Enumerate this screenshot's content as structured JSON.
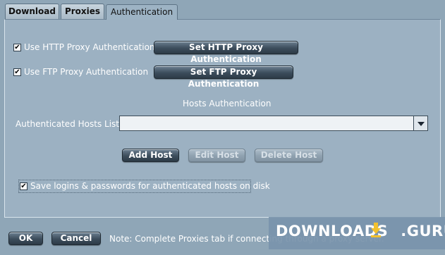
{
  "tabs": {
    "download": "Download",
    "proxies": "Proxies",
    "authentication": "Authentication"
  },
  "http": {
    "label": "Use HTTP Proxy Authentication",
    "checked": "✔",
    "button": "Set HTTP Proxy Authentication"
  },
  "ftp": {
    "label": "Use FTP Proxy Authentication",
    "checked": "✔",
    "button": "Set FTP Proxy Authentication"
  },
  "hosts": {
    "heading": "Hosts Authentication",
    "list_label": "Authenticated Hosts List:",
    "list_value": "",
    "add": "Add Host",
    "edit": "Edit Host",
    "delete": "Delete Host"
  },
  "save": {
    "label": "Save logins & passwords for authenticated hosts on disk",
    "checked": "✔"
  },
  "footer": {
    "ok": "OK",
    "cancel": "Cancel",
    "note": "Note: Complete Proxies tab if connecting through a proxy server."
  },
  "watermark": {
    "left": "DOWNLOADS",
    "right": ".GURU"
  },
  "colors": {
    "background": "#8fa6b7",
    "panel": "#9cb1c2",
    "button": "#3c4d5c"
  }
}
